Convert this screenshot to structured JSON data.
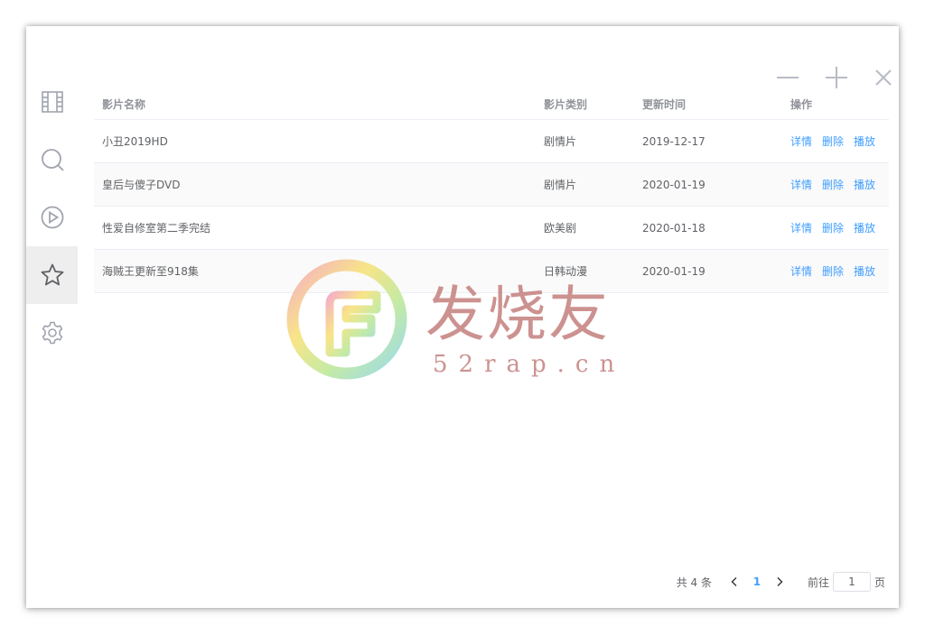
{
  "window_controls": {
    "minimize_icon": "minimize-icon",
    "maximize_icon": "plus-icon",
    "close_icon": "close-icon"
  },
  "sidebar": {
    "items": [
      {
        "name": "film",
        "icon": "film-icon",
        "active": false
      },
      {
        "name": "search",
        "icon": "search-icon",
        "active": false
      },
      {
        "name": "play",
        "icon": "play-icon",
        "active": false
      },
      {
        "name": "favorites",
        "icon": "star-icon",
        "active": true
      },
      {
        "name": "settings",
        "icon": "gear-icon",
        "active": false
      }
    ]
  },
  "table": {
    "columns": [
      "影片名称",
      "影片类别",
      "更新时间",
      "操作"
    ],
    "rows": [
      {
        "name": "小丑2019HD",
        "category": "剧情片",
        "updated": "2019-12-17",
        "actions": [
          "详情",
          "删除",
          "播放"
        ]
      },
      {
        "name": "皇后与傻子DVD",
        "category": "剧情片",
        "updated": "2020-01-19",
        "actions": [
          "详情",
          "删除",
          "播放"
        ]
      },
      {
        "name": "性爱自修室第二季完结",
        "category": "欧美剧",
        "updated": "2020-01-18",
        "actions": [
          "详情",
          "删除",
          "播放"
        ]
      },
      {
        "name": "海贼王更新至918集",
        "category": "日韩动漫",
        "updated": "2020-01-19",
        "actions": [
          "详情",
          "删除",
          "播放"
        ]
      }
    ]
  },
  "pagination": {
    "total_text": "共 4 条",
    "current_page": "1",
    "goto_label": "前往",
    "goto_value": "1",
    "page_suffix": "页"
  },
  "watermark": {
    "text_cn": "发烧友",
    "text_en": "52rap.cn"
  },
  "colors": {
    "link": "#409eff",
    "header_text": "#909399",
    "body_text": "#606266",
    "border": "#ebeef5",
    "active_sidebar": "#eeeeee",
    "watermark": "#c47f7d"
  }
}
